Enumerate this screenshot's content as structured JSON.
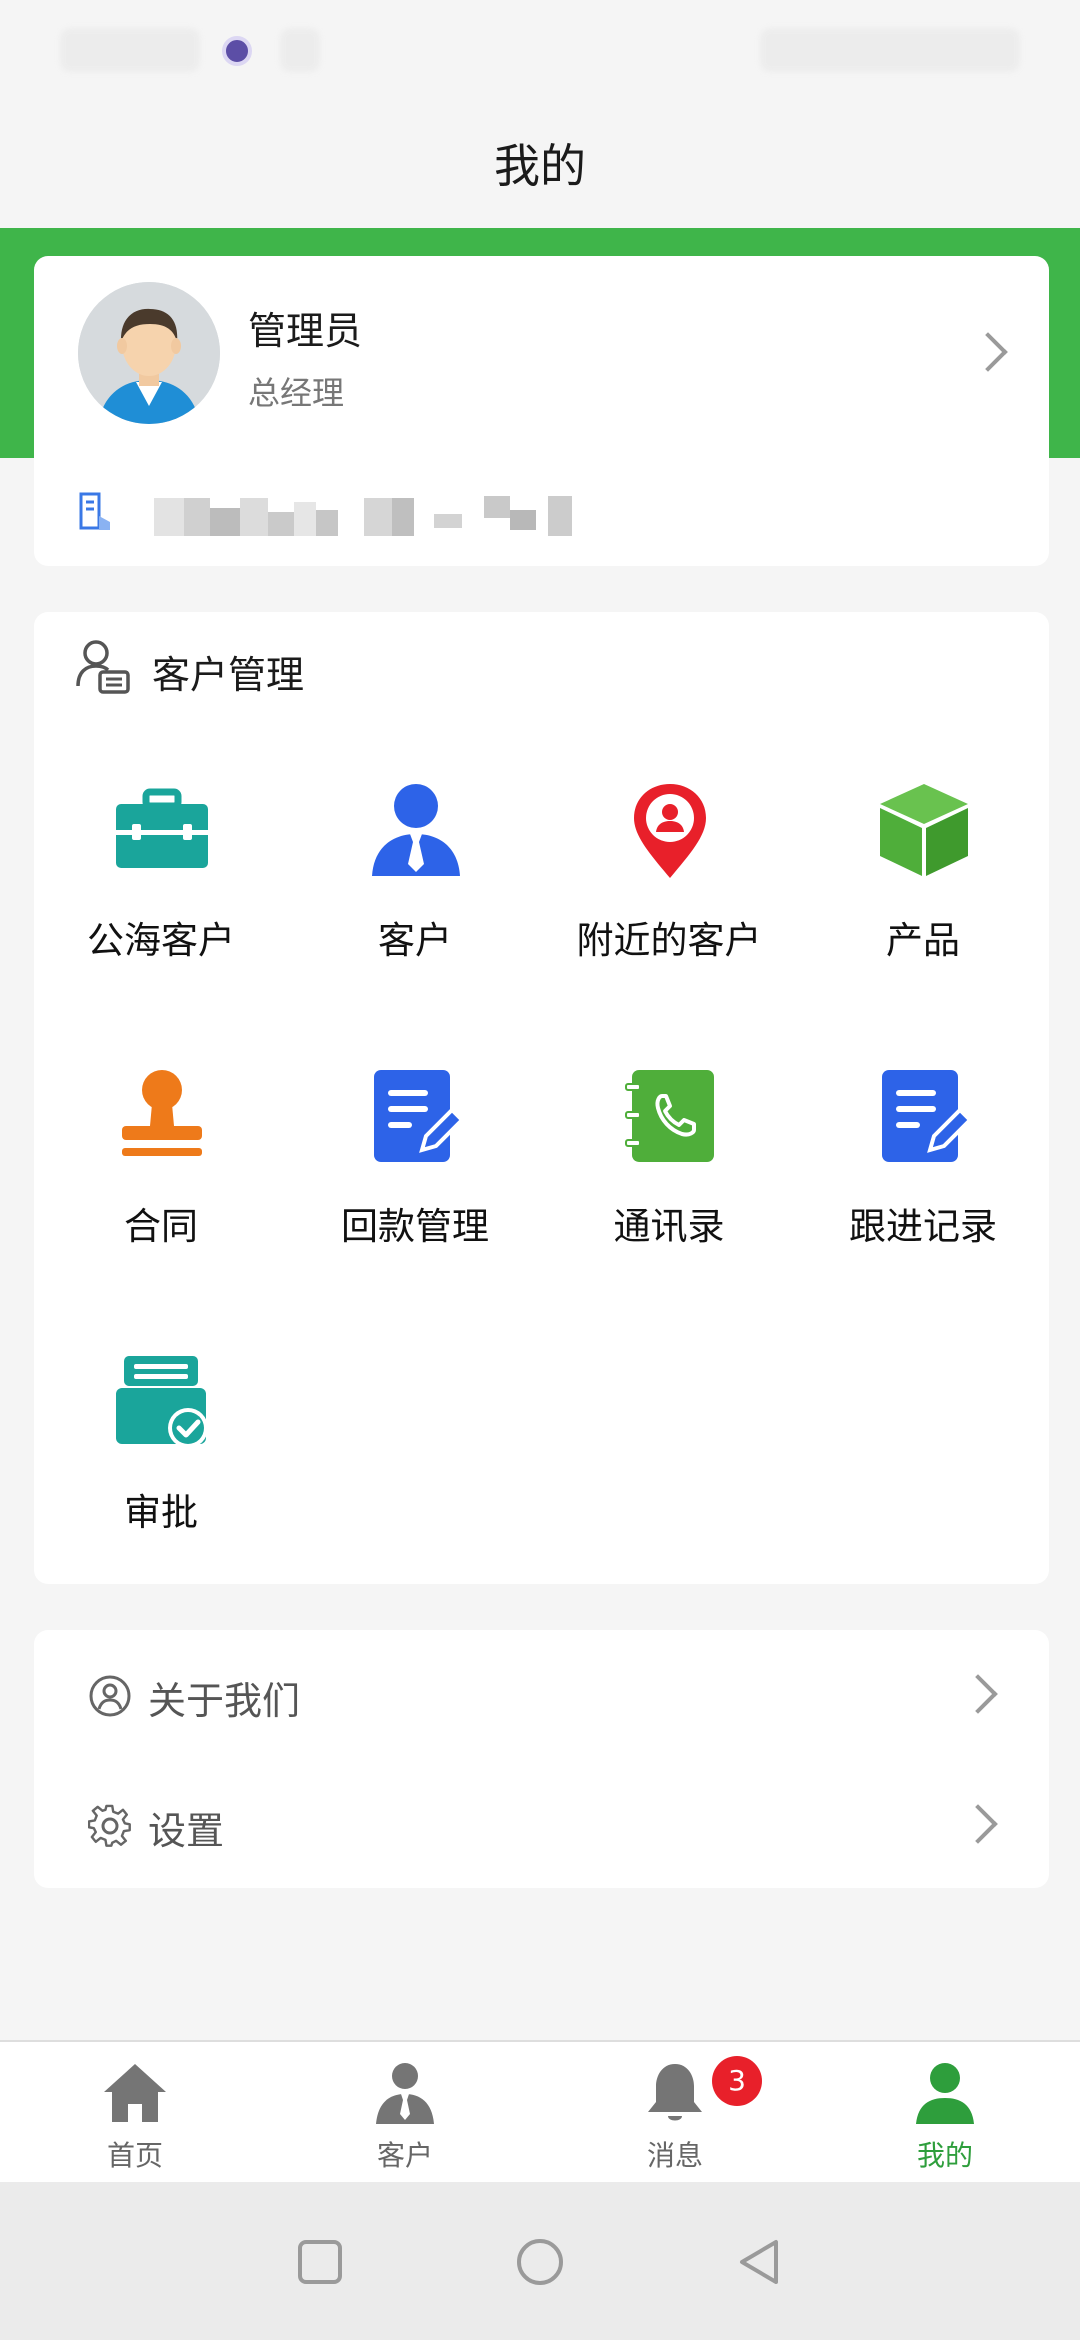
{
  "header": {
    "title": "我的"
  },
  "profile": {
    "name": "管理员",
    "role": "总经理"
  },
  "customer_management": {
    "title": "客户管理",
    "items": [
      {
        "label": "公海客户",
        "icon": "briefcase-icon",
        "color": "#1aa59b"
      },
      {
        "label": "客户",
        "icon": "person-tie-icon",
        "color": "#2d63e8"
      },
      {
        "label": "附近的客户",
        "icon": "location-pin-icon",
        "color": "#e8202a"
      },
      {
        "label": "产品",
        "icon": "cube-icon",
        "color": "#4fae3a"
      },
      {
        "label": "合同",
        "icon": "stamp-icon",
        "color": "#ee7a1a"
      },
      {
        "label": "回款管理",
        "icon": "document-edit-icon",
        "color": "#2d63e8"
      },
      {
        "label": "通讯录",
        "icon": "phone-book-icon",
        "color": "#4fae3a"
      },
      {
        "label": "跟进记录",
        "icon": "document-edit-icon",
        "color": "#2d63e8"
      },
      {
        "label": "审批",
        "icon": "approval-icon",
        "color": "#1aa59b"
      }
    ]
  },
  "settings": {
    "items": [
      {
        "label": "关于我们",
        "icon": "user-circle-icon"
      },
      {
        "label": "设置",
        "icon": "gear-icon"
      }
    ]
  },
  "tabbar": {
    "tabs": [
      {
        "label": "首页",
        "icon": "home-icon"
      },
      {
        "label": "客户",
        "icon": "customer-icon"
      },
      {
        "label": "消息",
        "icon": "bell-icon",
        "badge": "3"
      },
      {
        "label": "我的",
        "icon": "user-icon",
        "active": true
      }
    ],
    "active_color": "#2e9e3c"
  },
  "colors": {
    "brand_green": "#3fb54a",
    "badge_red": "#e8202a"
  }
}
